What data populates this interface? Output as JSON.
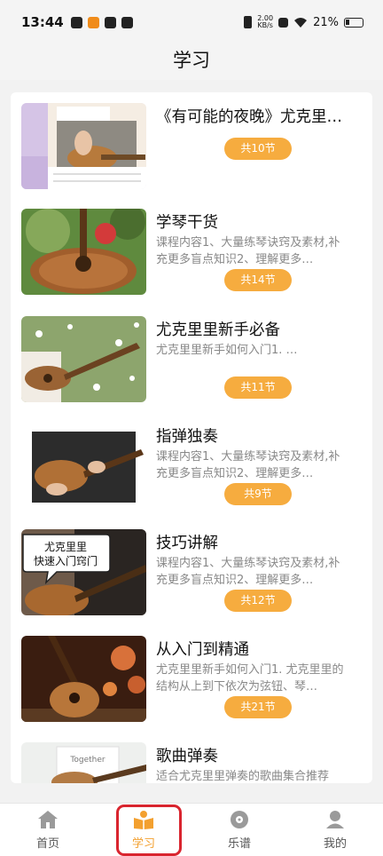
{
  "status": {
    "time": "13:44",
    "netspeed_value": "2.00",
    "netspeed_unit": "KB/s",
    "battery": "21%"
  },
  "page": {
    "title": "学习"
  },
  "courses": [
    {
      "title": "《有可能的夜晚》尤克里…",
      "desc": "",
      "count": "共10节"
    },
    {
      "title": "学琴干货",
      "desc": "课程内容1、大量练琴诀窍及素材,补充更多盲点知识2、理解更多…",
      "count": "共14节"
    },
    {
      "title": "尤克里里新手必备",
      "desc": "尤克里里新手如何入门1. …",
      "count": "共11节"
    },
    {
      "title": "指弹独奏",
      "desc": "课程内容1、大量练琴诀窍及素材,补充更多盲点知识2、理解更多…",
      "count": "共9节"
    },
    {
      "title": "技巧讲解",
      "desc": "课程内容1、大量练琴诀窍及素材,补充更多盲点知识2、理解更多…",
      "count": "共12节"
    },
    {
      "title": "从入门到精通",
      "desc": "尤克里里新手如何入门1. 尤克里里的结构从上到下依次为弦钮、琴…",
      "count": "共21节"
    },
    {
      "title": "歌曲弹奏",
      "desc": "适合尤克里里弹奏的歌曲集合推荐",
      "count": ""
    }
  ],
  "thumb_text": {
    "bubble_line1": "尤克里里",
    "bubble_line2": "快速入门窍门",
    "shirt": "Together"
  },
  "tabs": [
    {
      "label": "首页",
      "icon": "home-icon"
    },
    {
      "label": "学习",
      "icon": "book-icon"
    },
    {
      "label": "乐谱",
      "icon": "disc-icon"
    },
    {
      "label": "我的",
      "icon": "profile-icon"
    }
  ],
  "colors": {
    "accent": "#f6ac3f",
    "active_tab": "#f3a02f",
    "highlight": "#d9252f"
  }
}
